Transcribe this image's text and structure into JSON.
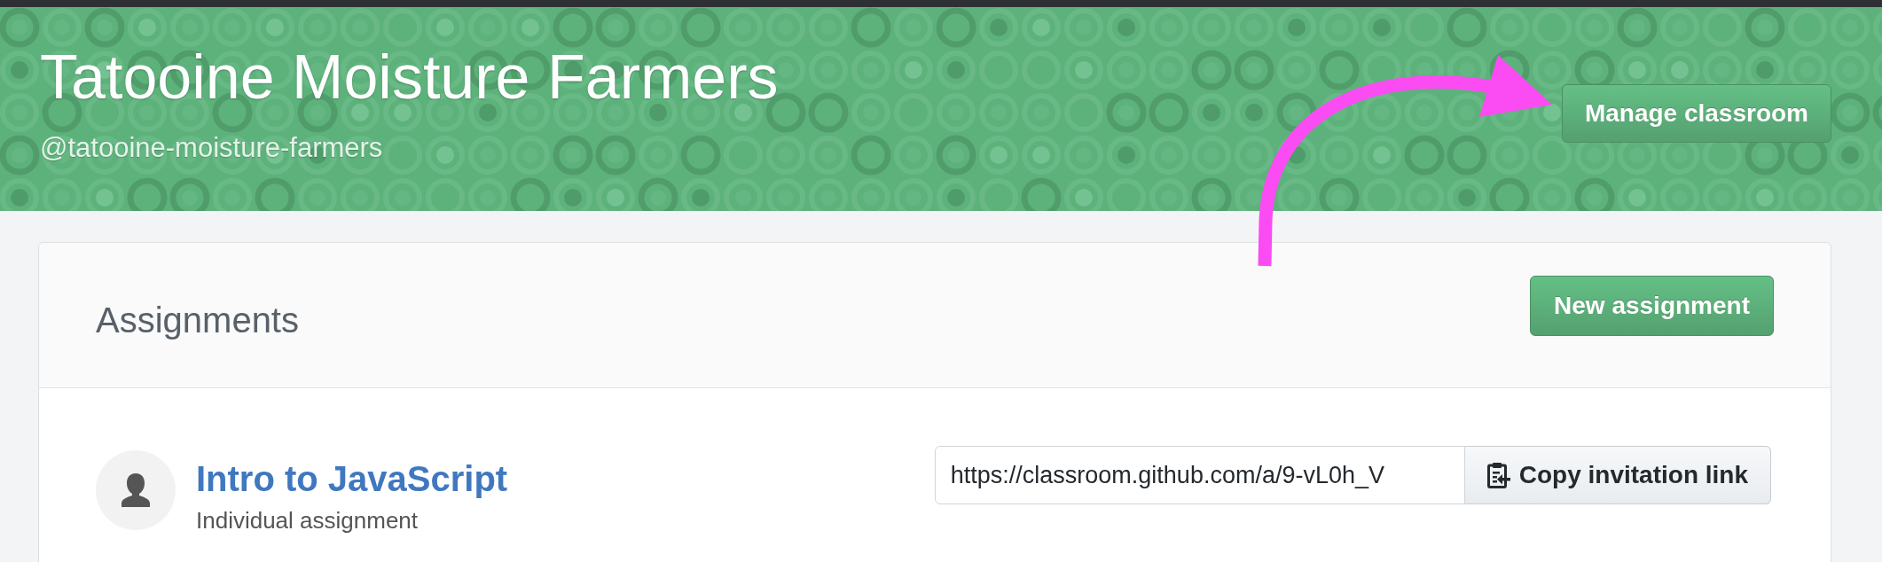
{
  "header": {
    "title": "Tatooine Moisture Farmers",
    "handle": "@tatooine-moisture-farmers",
    "button": "Manage classroom"
  },
  "assignments": {
    "title": "Assignments",
    "new_button": "New assignment",
    "items": [
      {
        "title": "Intro to JavaScript",
        "subtitle": "Individual assignment",
        "invitation_url": "https://classroom.github.com/a/9-vL0h_V",
        "copy_button": "Copy invitation link"
      }
    ]
  }
}
